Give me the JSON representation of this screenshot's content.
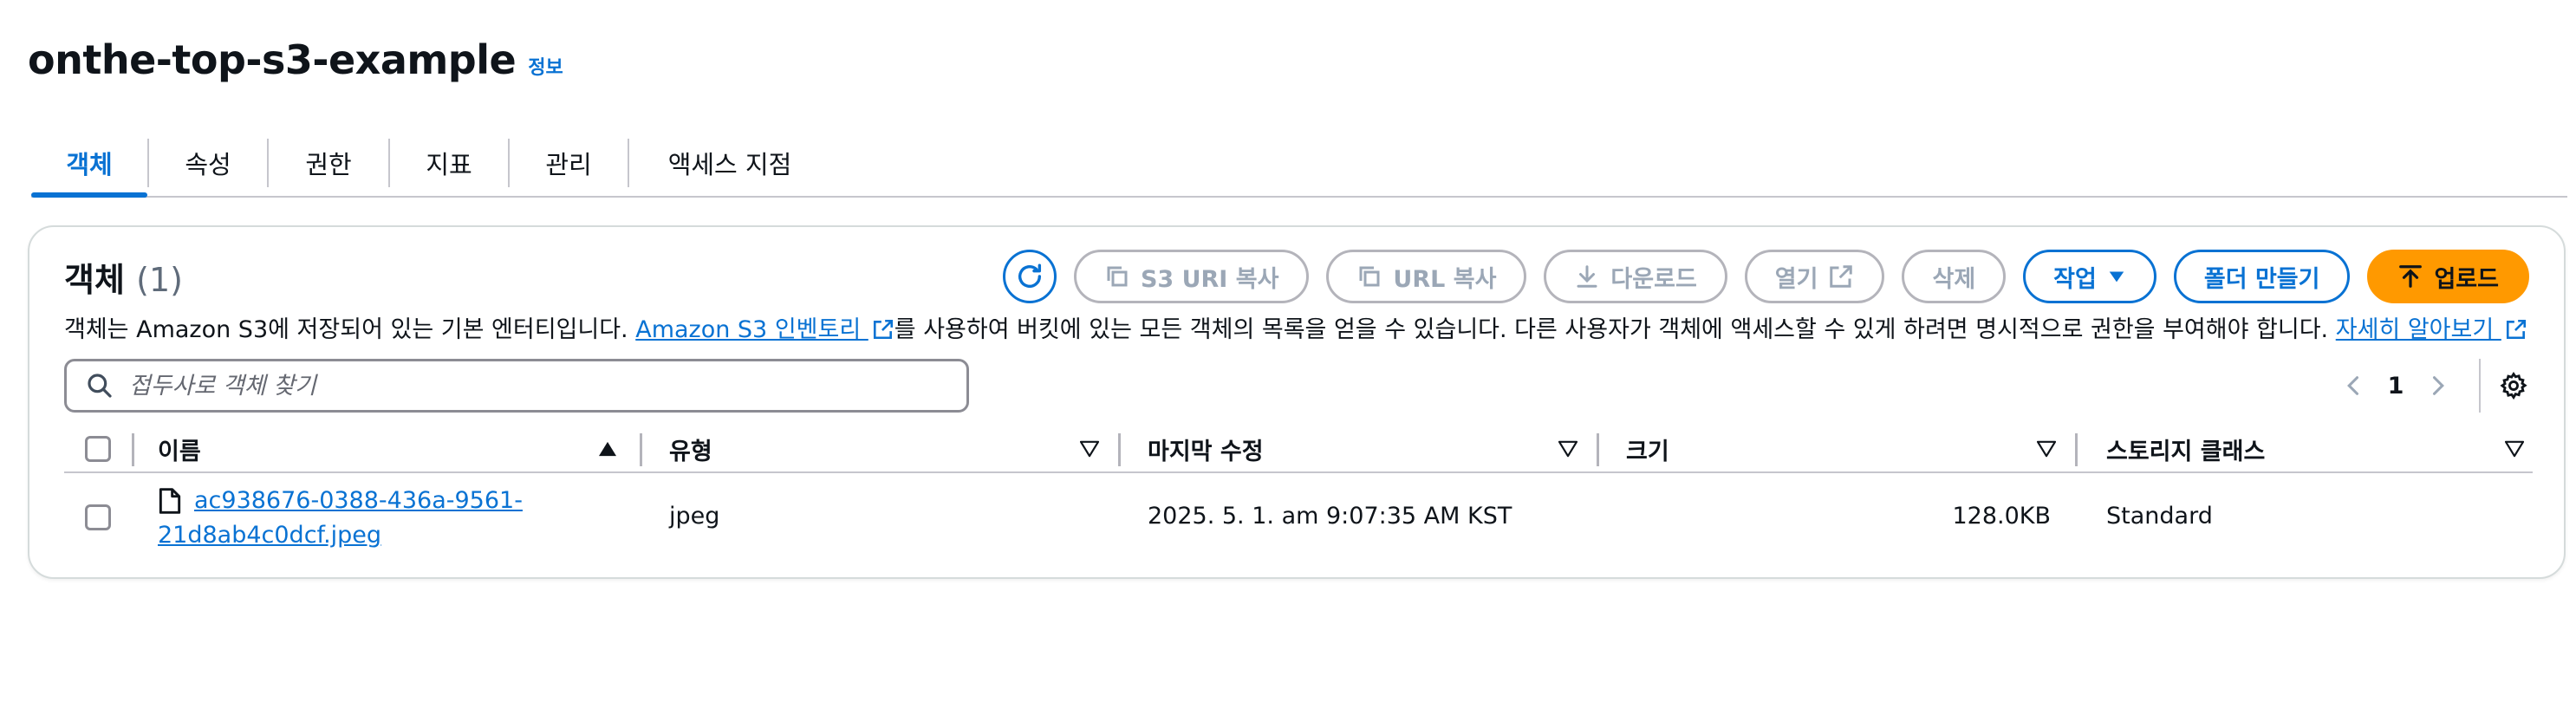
{
  "page": {
    "title": "onthe-top-s3-example",
    "info_label": "정보"
  },
  "tabs": [
    "객체",
    "속성",
    "권한",
    "지표",
    "관리",
    "액세스 지점"
  ],
  "objects_panel": {
    "title": "객체",
    "count": "(1)",
    "buttons": {
      "copy_s3_uri": "S3 URI 복사",
      "copy_url": "URL 복사",
      "download": "다운로드",
      "open": "열기",
      "delete": "삭제",
      "actions": "작업",
      "create_folder": "폴더 만들기",
      "upload": "업로드"
    },
    "description": {
      "part1": "객체는 Amazon S3에 저장되어 있는 기본 엔터티입니다. ",
      "link1": "Amazon S3 인벤토리 ",
      "part2": "를 사용하여 버킷에 있는 모든 객체의 목록을 얻을 수 있습니다. 다른 사용자가 객체에 액세스할 수 있게 하려면 명시적으로 권한을 부여해야 합니다. ",
      "link2": "자세히 알아보기 "
    },
    "search": {
      "placeholder": "접두사로 객체 찾기",
      "value": ""
    },
    "pagination": {
      "current_page": "1"
    },
    "table": {
      "columns": [
        "이름",
        "유형",
        "마지막 수정",
        "크기",
        "스토리지 클래스"
      ],
      "rows": [
        {
          "name_line1": "ac938676-0388-436a-9561-",
          "name_line2": "21d8ab4c0dcf.jpeg",
          "type": "jpeg",
          "last_modified": "2025. 5. 1. am 9:07:35 AM KST",
          "size": "128.0KB",
          "storage_class": "Standard"
        }
      ]
    }
  },
  "colors": {
    "accent": "#0972d3",
    "primary_button": "#ff9900",
    "disabled_text": "#9ba7b6",
    "border": "#c6c6cd"
  },
  "icons": {
    "refresh": "refresh-icon",
    "copy": "copy-icon",
    "download": "download-icon",
    "external": "external-link-icon",
    "caret_down": "caret-down-icon",
    "upload": "upload-icon",
    "search": "search-icon",
    "chevron_left": "chevron-left-icon",
    "chevron_right": "chevron-right-icon",
    "settings": "gear-icon",
    "file": "file-icon",
    "sort_asc": "sort-ascending-icon",
    "sort_desc": "sort-descending-icon"
  }
}
